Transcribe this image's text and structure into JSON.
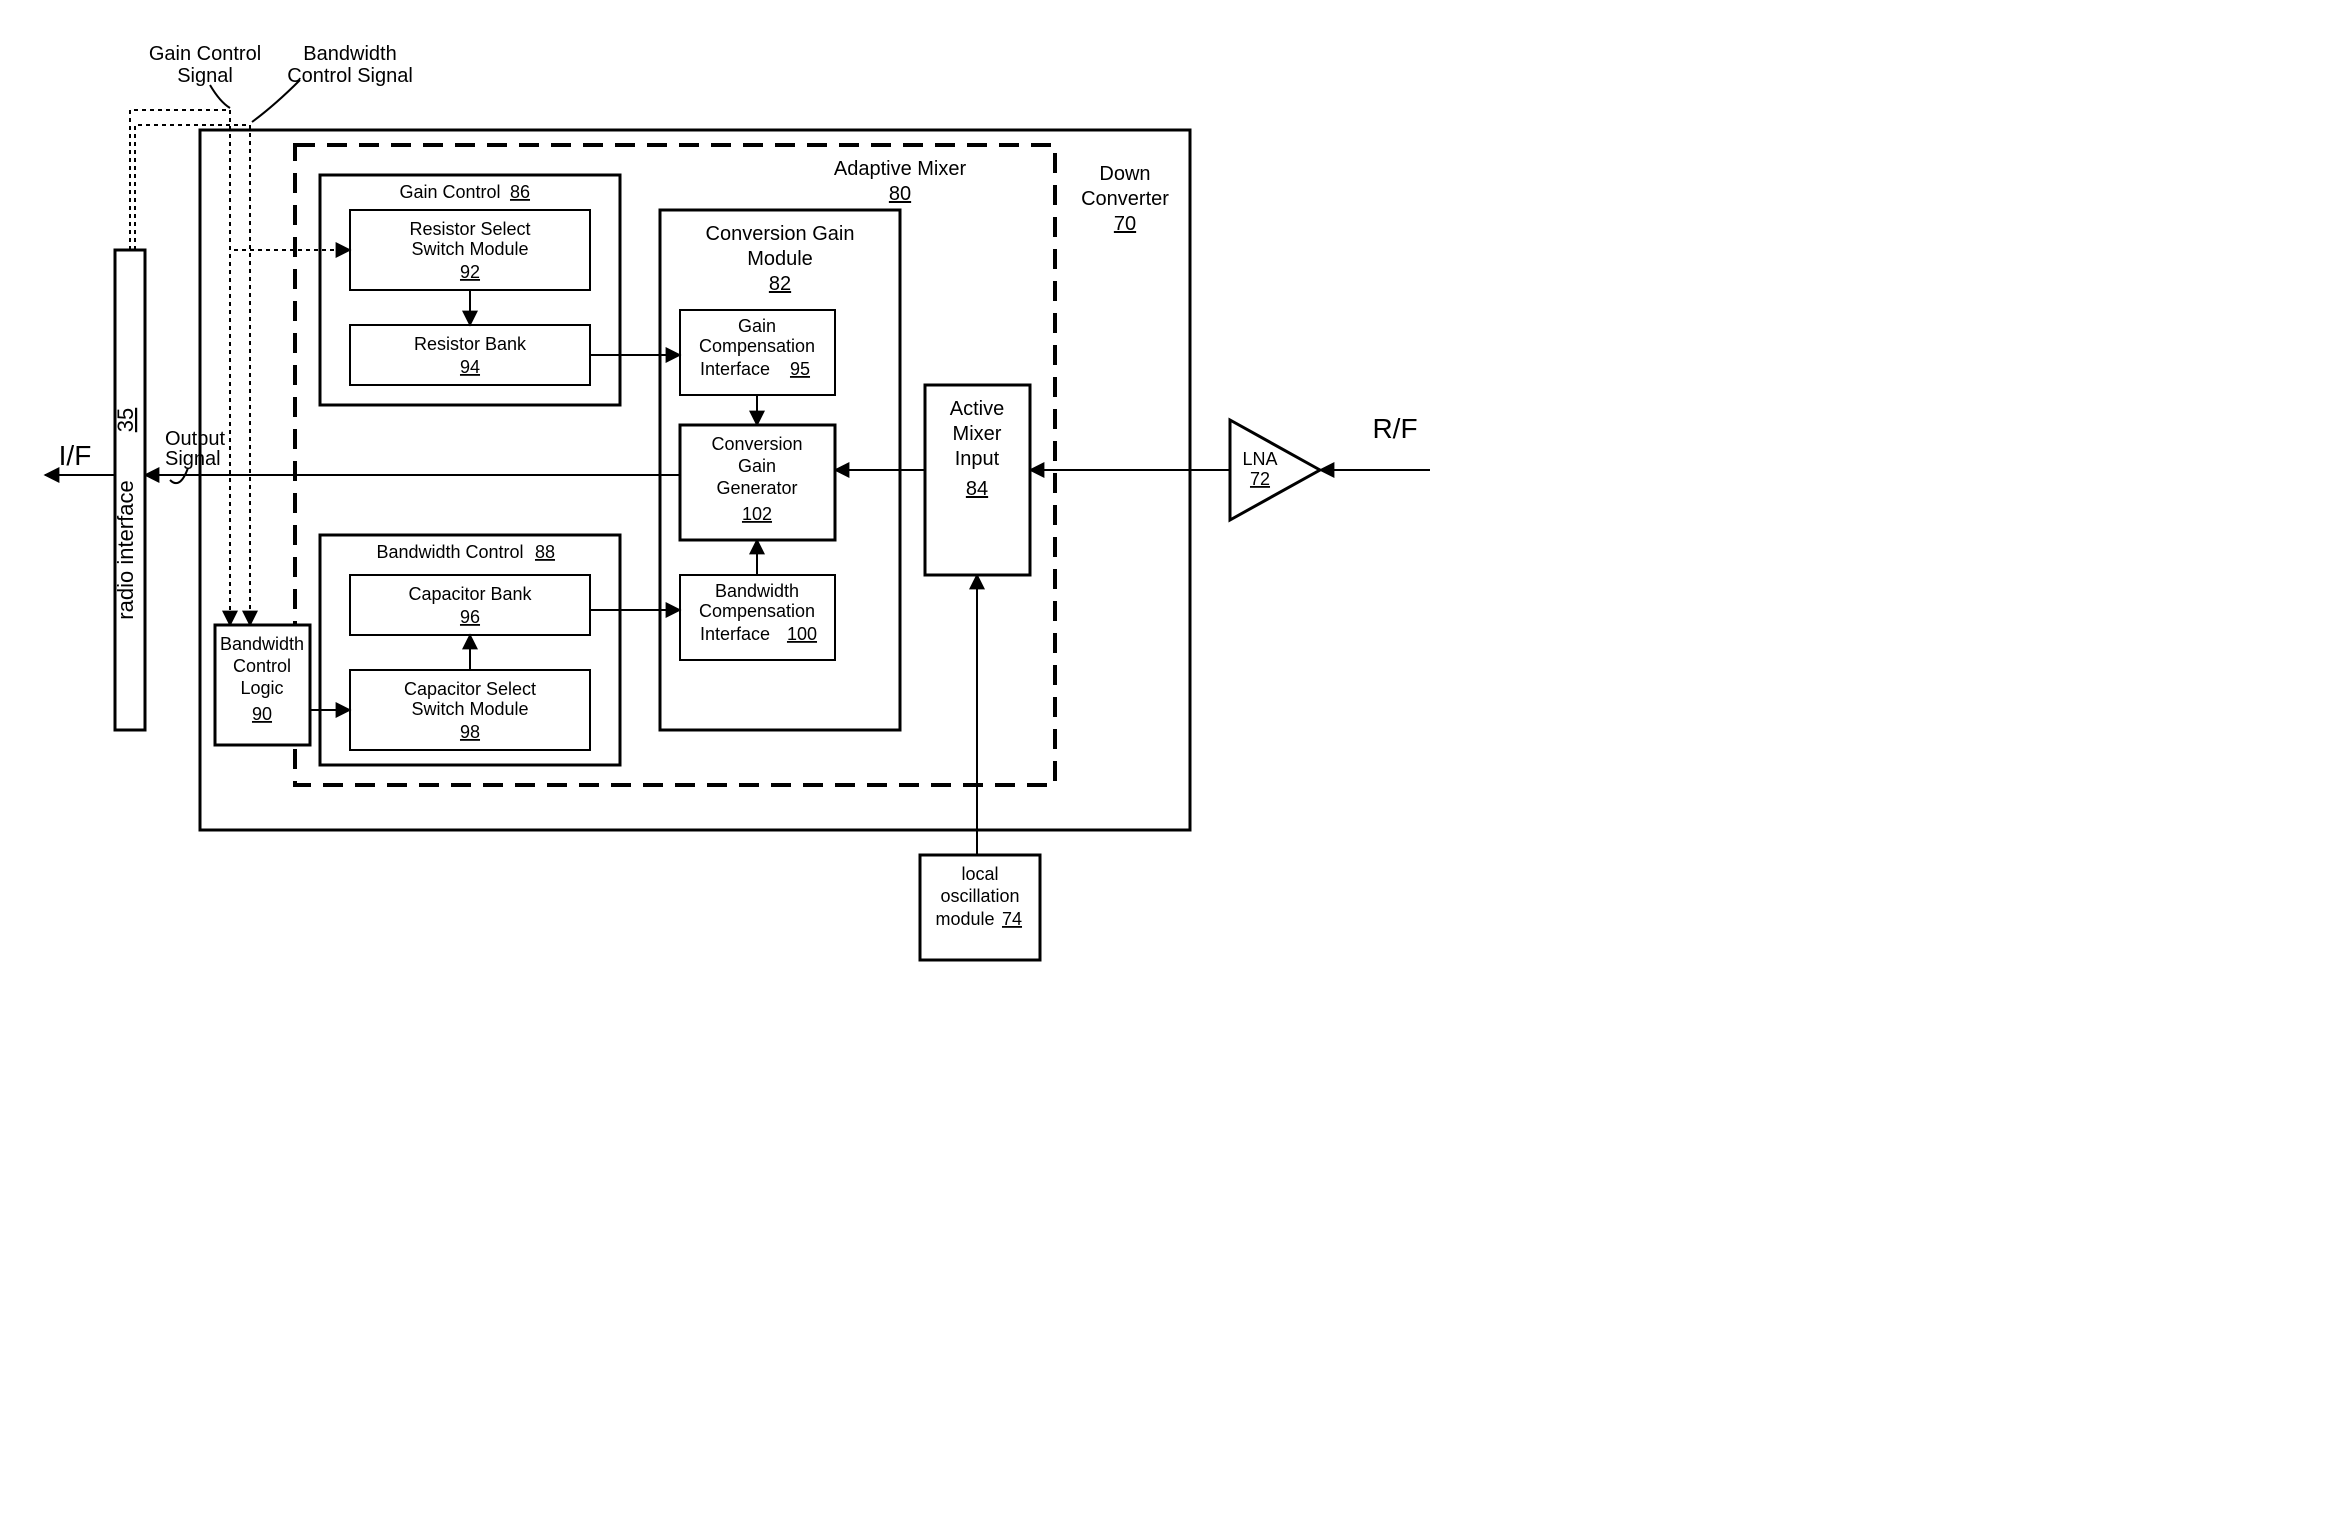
{
  "labels": {
    "gain_control_signal_1": "Gain Control",
    "gain_control_signal_2": "Signal",
    "bandwidth_control_signal_1": "Bandwidth",
    "bandwidth_control_signal_2": "Control Signal",
    "output_signal_1": "Output",
    "output_signal_2": "Signal",
    "if": "I/F",
    "rf": "R/F",
    "radio_interface": "radio interface",
    "radio_interface_ref": "35",
    "down_converter_1": "Down",
    "down_converter_2": "Converter",
    "down_converter_ref": "70",
    "adaptive_mixer": "Adaptive Mixer",
    "adaptive_mixer_ref": "80",
    "gain_control": "Gain Control",
    "gain_control_ref": "86",
    "resistor_select_1": "Resistor Select",
    "resistor_select_2": "Switch Module",
    "resistor_select_ref": "92",
    "resistor_bank": "Resistor Bank",
    "resistor_bank_ref": "94",
    "bandwidth_control": "Bandwidth Control",
    "bandwidth_control_ref": "88",
    "capacitor_bank": "Capacitor Bank",
    "capacitor_bank_ref": "96",
    "capacitor_select_1": "Capacitor Select",
    "capacitor_select_2": "Switch Module",
    "capacitor_select_ref": "98",
    "bandwidth_control_logic_1": "Bandwidth",
    "bandwidth_control_logic_2": "Control",
    "bandwidth_control_logic_3": "Logic",
    "bandwidth_control_logic_ref": "90",
    "conversion_gain_module_1": "Conversion Gain",
    "conversion_gain_module_2": "Module",
    "conversion_gain_module_ref": "82",
    "gain_comp_1": "Gain",
    "gain_comp_2": "Compensation",
    "gain_comp_3": "Interface",
    "gain_comp_ref": "95",
    "conversion_gain_gen_1": "Conversion",
    "conversion_gain_gen_2": "Gain",
    "conversion_gain_gen_3": "Generator",
    "conversion_gain_gen_ref": "102",
    "bandwidth_comp_1": "Bandwidth",
    "bandwidth_comp_2": "Compensation",
    "bandwidth_comp_3": "Interface",
    "bandwidth_comp_ref": "100",
    "active_mixer_1": "Active",
    "active_mixer_2": "Mixer",
    "active_mixer_3": "Input",
    "active_mixer_ref": "84",
    "lna": "LNA",
    "lna_ref": "72",
    "local_osc_1": "local",
    "local_osc_2": "oscillation",
    "local_osc_3": "module",
    "local_osc_ref": "74"
  }
}
